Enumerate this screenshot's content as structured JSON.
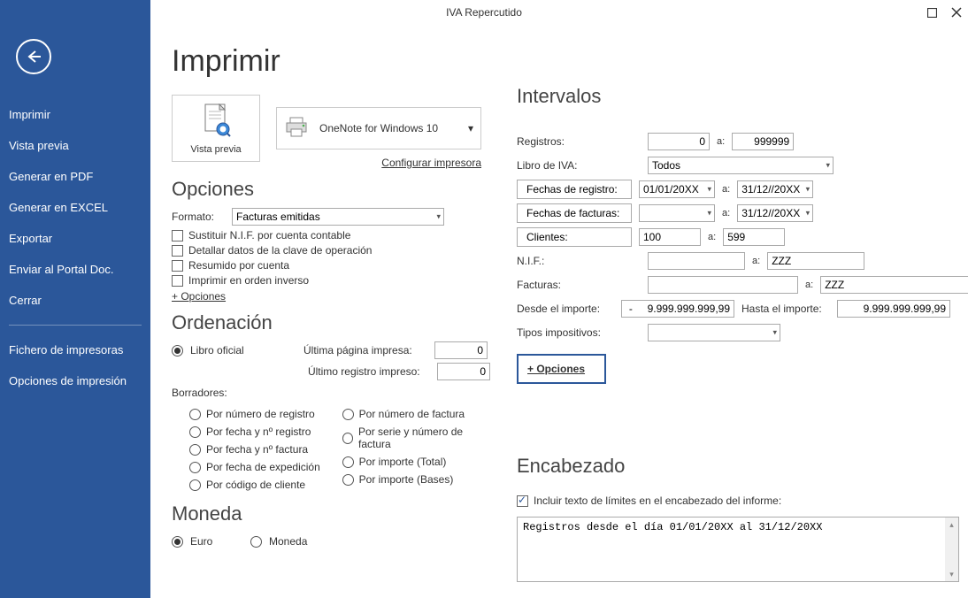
{
  "window": {
    "title": "IVA Repercutido"
  },
  "sidebar": {
    "items": [
      "Imprimir",
      "Vista previa",
      "Generar en PDF",
      "Generar en EXCEL",
      "Exportar",
      "Enviar al Portal Doc.",
      "Cerrar"
    ],
    "items2": [
      "Fichero de impresoras",
      "Opciones de impresión"
    ]
  },
  "page": {
    "title": "Imprimir"
  },
  "preview": {
    "label": "Vista previa"
  },
  "printer": {
    "name": "OneNote for Windows 10",
    "configure": "Configurar impresora"
  },
  "opciones": {
    "heading": "Opciones",
    "formato_label": "Formato:",
    "formato_value": "Facturas emitidas",
    "chk1": "Sustituir N.I.F. por cuenta contable",
    "chk2": "Detallar datos de la clave de operación",
    "chk3": "Resumido por cuenta",
    "chk4": "Imprimir en orden inverso",
    "more": "+ Opciones"
  },
  "ordenacion": {
    "heading": "Ordenación",
    "libro": "Libro oficial",
    "ultima_pagina_label": "Última página impresa:",
    "ultima_pagina_value": "0",
    "ultimo_registro_label": "Último registro impreso:",
    "ultimo_registro_value": "0",
    "borradores_label": "Borradores:",
    "r1": "Por número de registro",
    "r2": "Por fecha y nº registro",
    "r3": "Por fecha y nº factura",
    "r4": "Por fecha de expedición",
    "r5": "Por código de cliente",
    "r6": "Por número de factura",
    "r7": "Por serie y número de factura",
    "r8": "Por importe (Total)",
    "r9": "Por importe (Bases)"
  },
  "moneda": {
    "heading": "Moneda",
    "euro": "Euro",
    "moneda": "Moneda"
  },
  "intervalos": {
    "heading": "Intervalos",
    "registros_label": "Registros:",
    "registros_from": "0",
    "registros_to": "999999",
    "a": "a:",
    "libro_iva_label": "Libro de IVA:",
    "libro_iva_value": "Todos",
    "fechas_registro_btn": "Fechas de registro:",
    "fechas_registro_from": "01/01/20XX",
    "fechas_registro_to": "31/12//20XX",
    "fechas_facturas_btn": "Fechas de facturas:",
    "fechas_facturas_from": "",
    "fechas_facturas_to": "31/12//20XX",
    "clientes_btn": "Clientes:",
    "clientes_from": "100",
    "clientes_to": "599",
    "nif_label": "N.I.F.:",
    "nif_from": "",
    "nif_to": "ZZZ",
    "facturas_label": "Facturas:",
    "facturas_from": "",
    "facturas_to": "ZZZ",
    "desde_importe_label": "Desde el importe:",
    "desde_importe_value": "-     9.999.999.999,99",
    "hasta_importe_label": "Hasta el importe:",
    "hasta_importe_value": "9.999.999.999,99",
    "tipos_label": "Tipos impositivos:",
    "tipos_value": "",
    "more": "+ Opciones"
  },
  "encabezado": {
    "heading": "Encabezado",
    "chk": "Incluir texto de límites en el encabezado del informe:",
    "text": "Registros desde el día 01/01/20XX al 31/12/20XX"
  }
}
